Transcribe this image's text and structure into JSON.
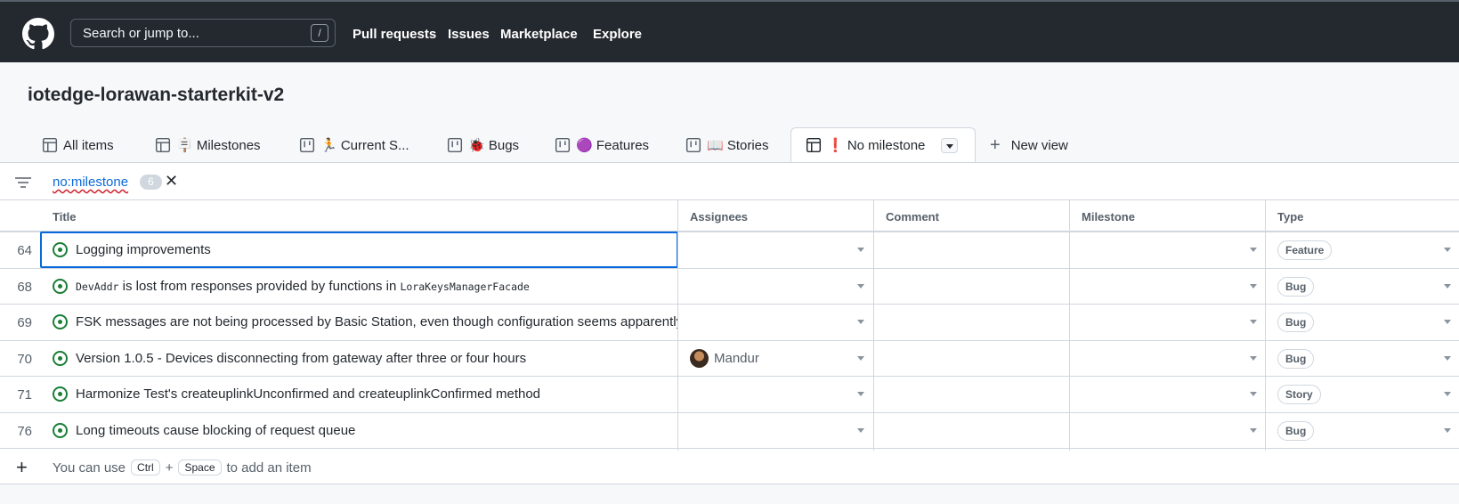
{
  "header": {
    "search_placeholder": "Search or jump to...",
    "search_shortcut": "/",
    "nav": [
      "Pull requests",
      "Issues",
      "Marketplace",
      "Explore"
    ]
  },
  "project": {
    "title": "iotedge-lorawan-starterkit-v2"
  },
  "tabs": [
    {
      "label": "All items",
      "icon": "table-icon"
    },
    {
      "label": "🪧 Milestones",
      "icon": "table-icon"
    },
    {
      "label": "🏃 Current S...",
      "icon": "board-icon"
    },
    {
      "label": "🐞 Bugs",
      "icon": "board-icon"
    },
    {
      "label": "🟣 Features",
      "icon": "board-icon"
    },
    {
      "label": "📖 Stories",
      "icon": "board-icon"
    },
    {
      "label": "❗ No milestone",
      "icon": "table-icon",
      "active": true
    },
    {
      "label": "New view",
      "icon": "plus-icon"
    }
  ],
  "filter": {
    "query": "no:milestone",
    "count": "6",
    "clear": "✕"
  },
  "table": {
    "columns": [
      "Title",
      "Assignees",
      "Comment",
      "Milestone",
      "Type"
    ],
    "rows": [
      {
        "num": "64",
        "title": "Logging improvements",
        "assignee": "",
        "type": "Feature"
      },
      {
        "num": "68",
        "title_code1": "DevAddr",
        "title_mid": " is lost from responses provided by functions in ",
        "title_code2": "LoraKeysManagerFacade",
        "assignee": "",
        "type": "Bug"
      },
      {
        "num": "69",
        "title": "FSK messages are not being processed by Basic Station, even though configuration seems apparently correct",
        "assignee": "",
        "type": "Bug"
      },
      {
        "num": "70",
        "title": "Version 1.0.5 - Devices disconnecting from gateway after three or four hours",
        "assignee": "Mandur",
        "type": "Bug"
      },
      {
        "num": "71",
        "title": "Harmonize Test's createuplinkUnconfirmed and createuplinkConfirmed method",
        "assignee": "",
        "type": "Story"
      },
      {
        "num": "76",
        "title": "Long timeouts cause blocking of request queue",
        "assignee": "",
        "type": "Bug"
      }
    ],
    "add_row": {
      "prefix": "You can use",
      "key1": "Ctrl",
      "plus": "+",
      "key2": "Space",
      "suffix": "to add an item"
    }
  }
}
